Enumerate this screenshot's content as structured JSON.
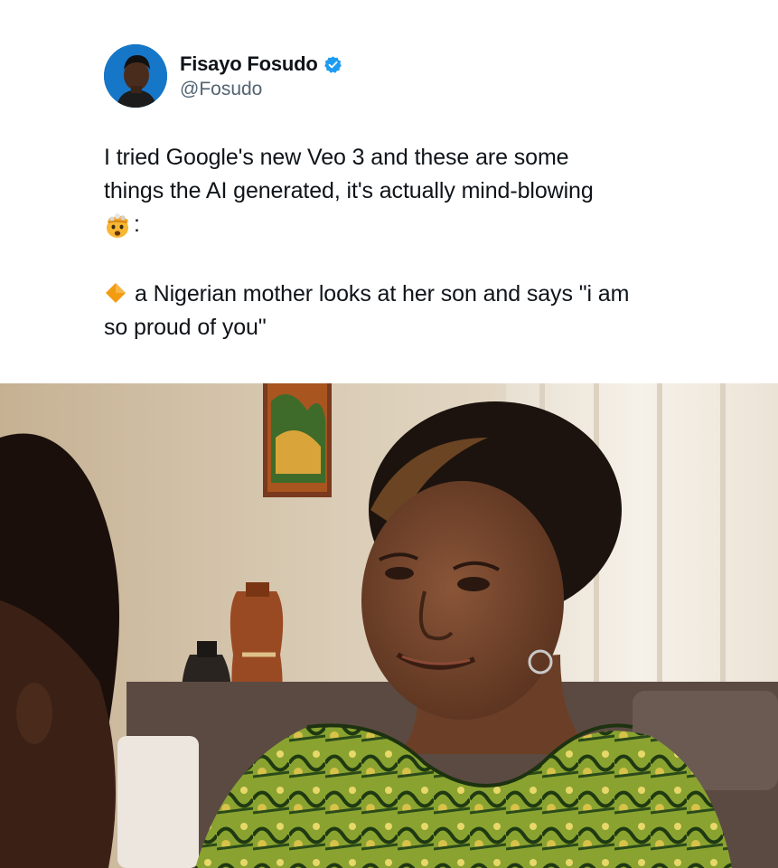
{
  "author": {
    "name": "Fisayo Fosudo",
    "handle": "@Fosudo",
    "verified": true,
    "verified_color": "#1d9bf0"
  },
  "post": {
    "text_line1": "I tried Google's new Veo 3 and these are some",
    "text_line2": "things the AI generated, it's actually mind-blowing",
    "text_line3_emoji": "exploding-head-emoji",
    "text_line3_suffix": ":",
    "bullet_icon": "orange-diamond-emoji",
    "prompt_line1": "a Nigerian mother looks at her son and says \"i am",
    "prompt_line2": "so proud of you\""
  },
  "media": {
    "type": "ai-generated video still"
  }
}
